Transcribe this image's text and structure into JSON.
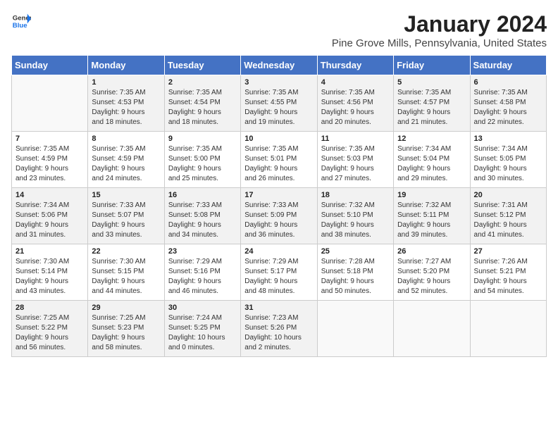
{
  "logo": {
    "general": "General",
    "blue": "Blue"
  },
  "title": "January 2024",
  "subtitle": "Pine Grove Mills, Pennsylvania, United States",
  "days_of_week": [
    "Sunday",
    "Monday",
    "Tuesday",
    "Wednesday",
    "Thursday",
    "Friday",
    "Saturday"
  ],
  "weeks": [
    [
      {
        "day": "",
        "info": ""
      },
      {
        "day": "1",
        "info": "Sunrise: 7:35 AM\nSunset: 4:53 PM\nDaylight: 9 hours\nand 18 minutes."
      },
      {
        "day": "2",
        "info": "Sunrise: 7:35 AM\nSunset: 4:54 PM\nDaylight: 9 hours\nand 18 minutes."
      },
      {
        "day": "3",
        "info": "Sunrise: 7:35 AM\nSunset: 4:55 PM\nDaylight: 9 hours\nand 19 minutes."
      },
      {
        "day": "4",
        "info": "Sunrise: 7:35 AM\nSunset: 4:56 PM\nDaylight: 9 hours\nand 20 minutes."
      },
      {
        "day": "5",
        "info": "Sunrise: 7:35 AM\nSunset: 4:57 PM\nDaylight: 9 hours\nand 21 minutes."
      },
      {
        "day": "6",
        "info": "Sunrise: 7:35 AM\nSunset: 4:58 PM\nDaylight: 9 hours\nand 22 minutes."
      }
    ],
    [
      {
        "day": "7",
        "info": "Sunrise: 7:35 AM\nSunset: 4:59 PM\nDaylight: 9 hours\nand 23 minutes."
      },
      {
        "day": "8",
        "info": "Sunrise: 7:35 AM\nSunset: 4:59 PM\nDaylight: 9 hours\nand 24 minutes."
      },
      {
        "day": "9",
        "info": "Sunrise: 7:35 AM\nSunset: 5:00 PM\nDaylight: 9 hours\nand 25 minutes."
      },
      {
        "day": "10",
        "info": "Sunrise: 7:35 AM\nSunset: 5:01 PM\nDaylight: 9 hours\nand 26 minutes."
      },
      {
        "day": "11",
        "info": "Sunrise: 7:35 AM\nSunset: 5:03 PM\nDaylight: 9 hours\nand 27 minutes."
      },
      {
        "day": "12",
        "info": "Sunrise: 7:34 AM\nSunset: 5:04 PM\nDaylight: 9 hours\nand 29 minutes."
      },
      {
        "day": "13",
        "info": "Sunrise: 7:34 AM\nSunset: 5:05 PM\nDaylight: 9 hours\nand 30 minutes."
      }
    ],
    [
      {
        "day": "14",
        "info": "Sunrise: 7:34 AM\nSunset: 5:06 PM\nDaylight: 9 hours\nand 31 minutes."
      },
      {
        "day": "15",
        "info": "Sunrise: 7:33 AM\nSunset: 5:07 PM\nDaylight: 9 hours\nand 33 minutes."
      },
      {
        "day": "16",
        "info": "Sunrise: 7:33 AM\nSunset: 5:08 PM\nDaylight: 9 hours\nand 34 minutes."
      },
      {
        "day": "17",
        "info": "Sunrise: 7:33 AM\nSunset: 5:09 PM\nDaylight: 9 hours\nand 36 minutes."
      },
      {
        "day": "18",
        "info": "Sunrise: 7:32 AM\nSunset: 5:10 PM\nDaylight: 9 hours\nand 38 minutes."
      },
      {
        "day": "19",
        "info": "Sunrise: 7:32 AM\nSunset: 5:11 PM\nDaylight: 9 hours\nand 39 minutes."
      },
      {
        "day": "20",
        "info": "Sunrise: 7:31 AM\nSunset: 5:12 PM\nDaylight: 9 hours\nand 41 minutes."
      }
    ],
    [
      {
        "day": "21",
        "info": "Sunrise: 7:30 AM\nSunset: 5:14 PM\nDaylight: 9 hours\nand 43 minutes."
      },
      {
        "day": "22",
        "info": "Sunrise: 7:30 AM\nSunset: 5:15 PM\nDaylight: 9 hours\nand 44 minutes."
      },
      {
        "day": "23",
        "info": "Sunrise: 7:29 AM\nSunset: 5:16 PM\nDaylight: 9 hours\nand 46 minutes."
      },
      {
        "day": "24",
        "info": "Sunrise: 7:29 AM\nSunset: 5:17 PM\nDaylight: 9 hours\nand 48 minutes."
      },
      {
        "day": "25",
        "info": "Sunrise: 7:28 AM\nSunset: 5:18 PM\nDaylight: 9 hours\nand 50 minutes."
      },
      {
        "day": "26",
        "info": "Sunrise: 7:27 AM\nSunset: 5:20 PM\nDaylight: 9 hours\nand 52 minutes."
      },
      {
        "day": "27",
        "info": "Sunrise: 7:26 AM\nSunset: 5:21 PM\nDaylight: 9 hours\nand 54 minutes."
      }
    ],
    [
      {
        "day": "28",
        "info": "Sunrise: 7:25 AM\nSunset: 5:22 PM\nDaylight: 9 hours\nand 56 minutes."
      },
      {
        "day": "29",
        "info": "Sunrise: 7:25 AM\nSunset: 5:23 PM\nDaylight: 9 hours\nand 58 minutes."
      },
      {
        "day": "30",
        "info": "Sunrise: 7:24 AM\nSunset: 5:25 PM\nDaylight: 10 hours\nand 0 minutes."
      },
      {
        "day": "31",
        "info": "Sunrise: 7:23 AM\nSunset: 5:26 PM\nDaylight: 10 hours\nand 2 minutes."
      },
      {
        "day": "",
        "info": ""
      },
      {
        "day": "",
        "info": ""
      },
      {
        "day": "",
        "info": ""
      }
    ]
  ]
}
